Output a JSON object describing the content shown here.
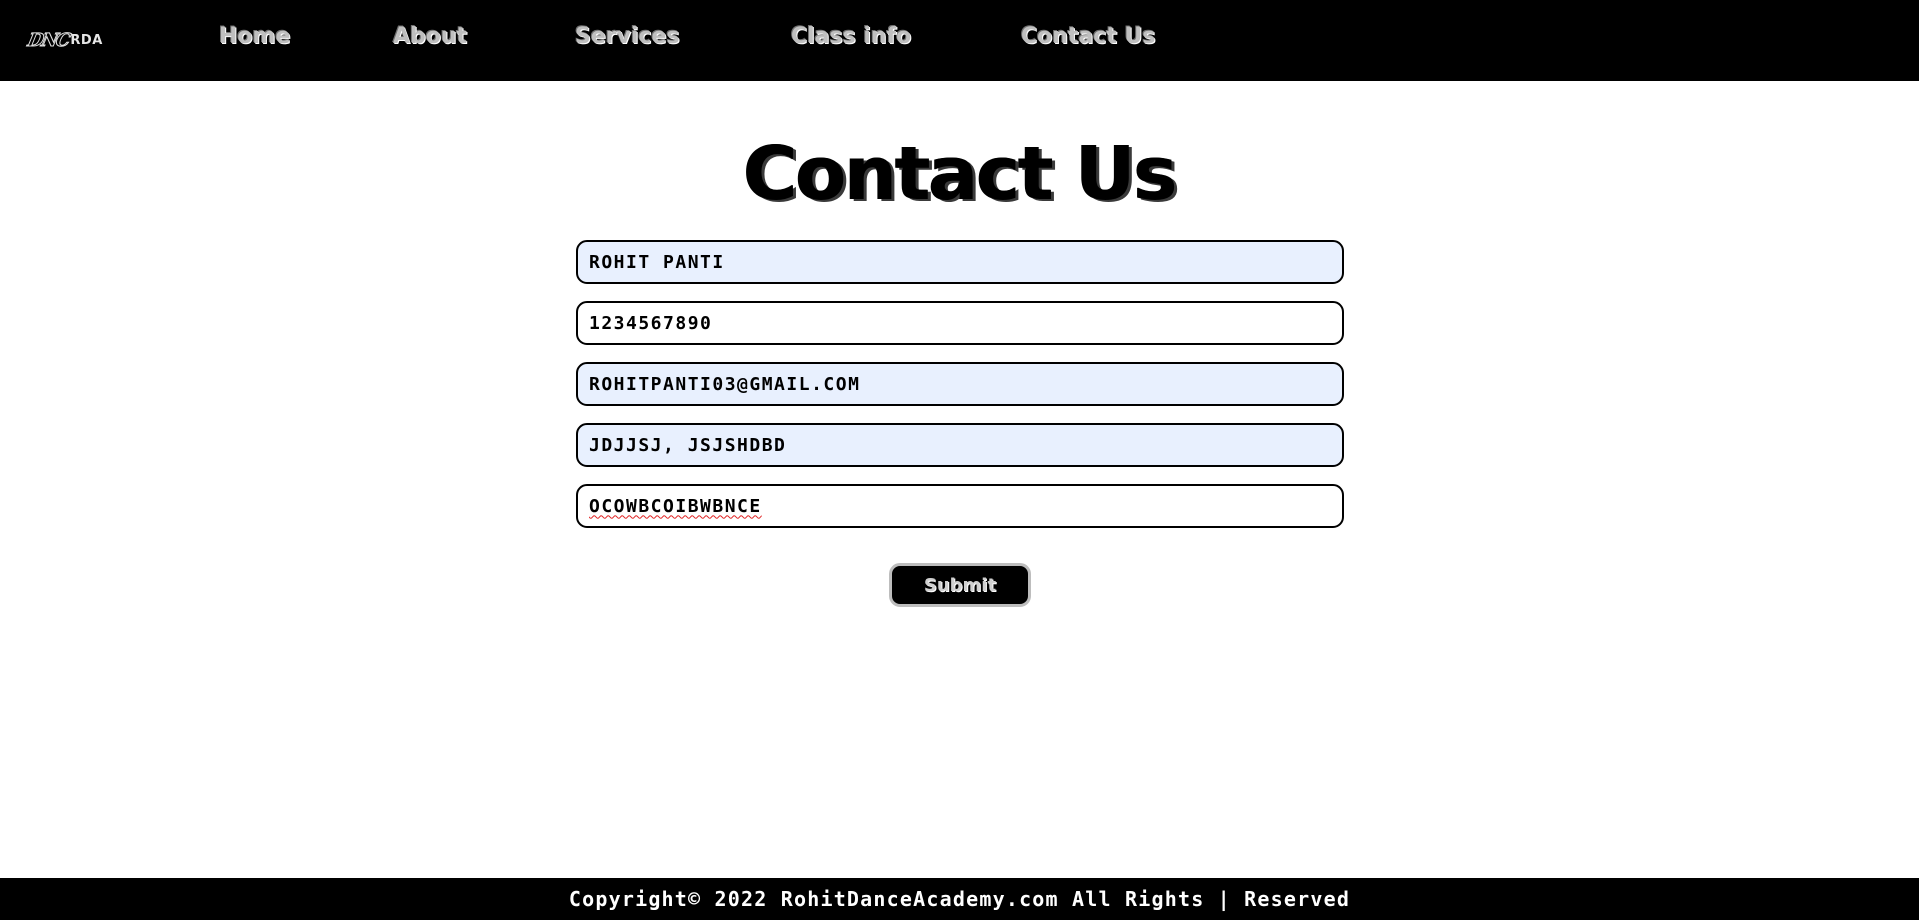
{
  "header": {
    "logo_mark": "DNC",
    "logo_text": "RDA",
    "nav": [
      {
        "label": "Home"
      },
      {
        "label": "About"
      },
      {
        "label": "Services"
      },
      {
        "label": "Class info"
      },
      {
        "label": "Contact Us"
      }
    ]
  },
  "main": {
    "title": "Contact Us",
    "form": {
      "fields": [
        {
          "value": "ROHIT PANTI"
        },
        {
          "value": "1234567890"
        },
        {
          "value": "ROHITPANTI03@GMAIL.COM"
        },
        {
          "value": "JDJJSJ, JSJSHDBD"
        },
        {
          "value": "OCOWBCOIBWBNCE"
        }
      ],
      "submit_label": "Submit"
    }
  },
  "footer": {
    "copyright": "Copyright© 2022 RohitDanceAcademy.com All Rights | Reserved"
  },
  "colors": {
    "bar_background": "#000000",
    "autofill_background": "#e8f0fe",
    "nav_text": "#bfbfbf"
  }
}
